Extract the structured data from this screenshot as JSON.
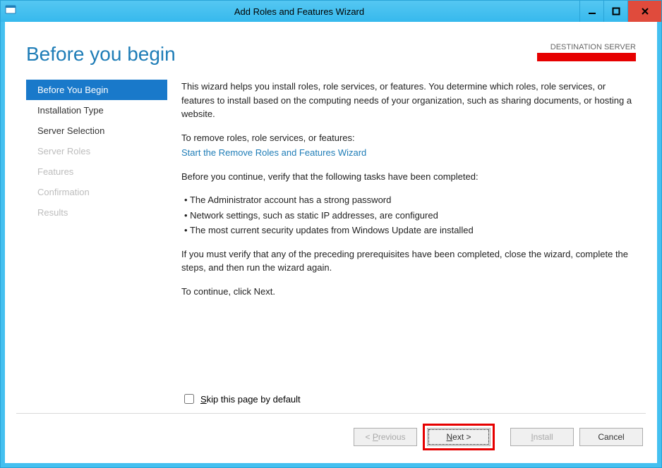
{
  "window": {
    "title": "Add Roles and Features Wizard"
  },
  "header": {
    "page_title": "Before you begin",
    "destination_label": "DESTINATION SERVER"
  },
  "nav": {
    "items": [
      {
        "label": "Before You Begin",
        "state": "active"
      },
      {
        "label": "Installation Type",
        "state": "enabled"
      },
      {
        "label": "Server Selection",
        "state": "enabled"
      },
      {
        "label": "Server Roles",
        "state": "disabled"
      },
      {
        "label": "Features",
        "state": "disabled"
      },
      {
        "label": "Confirmation",
        "state": "disabled"
      },
      {
        "label": "Results",
        "state": "disabled"
      }
    ]
  },
  "content": {
    "intro": "This wizard helps you install roles, role services, or features. You determine which roles, role services, or features to install based on the computing needs of your organization, such as sharing documents, or hosting a website.",
    "remove_heading": "To remove roles, role services, or features:",
    "remove_link": "Start the Remove Roles and Features Wizard",
    "verify_heading": "Before you continue, verify that the following tasks have been completed:",
    "bullets": [
      "The Administrator account has a strong password",
      "Network settings, such as static IP addresses, are configured",
      "The most current security updates from Windows Update are installed"
    ],
    "must_verify": "If you must verify that any of the preceding prerequisites have been completed, close the wizard, complete the steps, and then run the wizard again.",
    "continue": "To continue, click Next."
  },
  "skip": {
    "label_pre": "S",
    "label_rest": "kip this page by default"
  },
  "buttons": {
    "previous_pre": "< ",
    "previous_u": "P",
    "previous_rest": "revious",
    "next_u": "N",
    "next_rest": "ext >",
    "install_u": "I",
    "install_rest": "nstall",
    "cancel": "Cancel"
  }
}
